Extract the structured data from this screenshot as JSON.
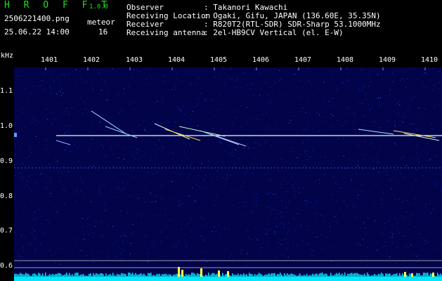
{
  "app": {
    "title": "H R O F F T",
    "version": "1.0.0",
    "filename": "2506221400.png",
    "datetime": "25.06.22 14:00",
    "mode_label": "meteor",
    "count": "16"
  },
  "info": {
    "rows": [
      {
        "key": "Observer",
        "value": ": Takanori Kawachi"
      },
      {
        "key": "Receiving Location",
        "value": ": Ogaki, Gifu, JAPAN (136.60E, 35.35N)"
      },
      {
        "key": "Receiver",
        "value": ": R820T2(RTL-SDR) SDR-Sharp 53.1000MHz"
      },
      {
        "key": "Receiving antenna",
        "value": ": 2el-HB9CV Vertical (el. E-W)"
      }
    ]
  },
  "plot": {
    "y_unit": "kHz",
    "x_ticks": [
      "1401",
      "1402",
      "1403",
      "1404",
      "1405",
      "1406",
      "1407",
      "1408",
      "1409",
      "1410"
    ],
    "y_ticks": [
      "1.1",
      "1.0",
      "0.9",
      "0.8",
      "0.7",
      "0.6"
    ],
    "colors": {
      "background": "#03034a",
      "noise": "#2a3cff",
      "trace": "#e8fff0",
      "meteor_hot": "#ffff40",
      "baseline": "#00e8ff"
    }
  }
}
